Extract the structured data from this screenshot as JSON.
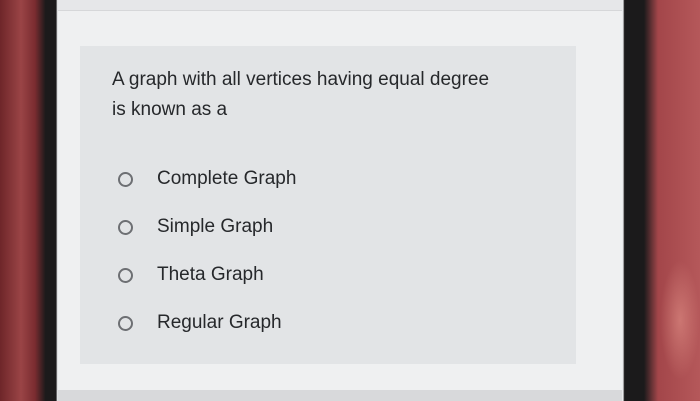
{
  "question": {
    "line1": "A graph with all vertices having equal degree",
    "line2": "is known as a"
  },
  "options": [
    {
      "label": "Complete Graph",
      "selected": false
    },
    {
      "label": "Simple Graph",
      "selected": false
    },
    {
      "label": "Theta Graph",
      "selected": false
    },
    {
      "label": "Regular Graph",
      "selected": false
    }
  ]
}
